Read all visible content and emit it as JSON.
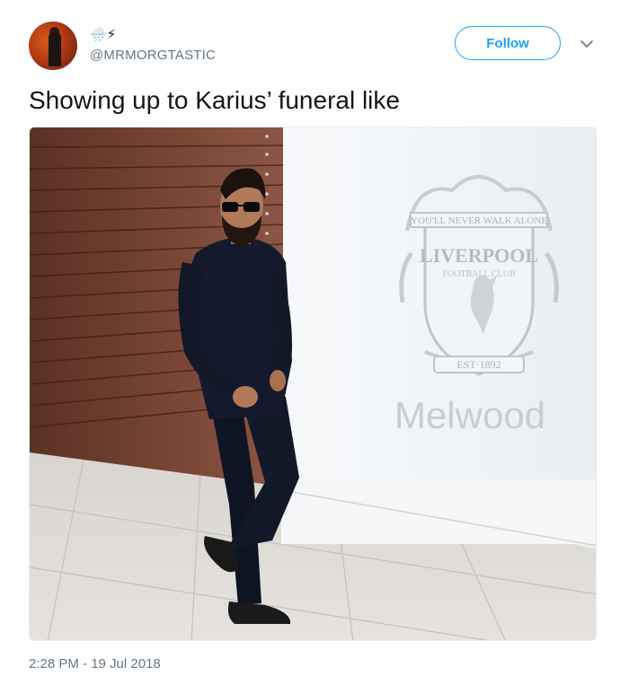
{
  "user": {
    "handle": "@MRMORGTASTIC",
    "name_emoji": "🌧️⚡"
  },
  "follow_button": {
    "label": "Follow"
  },
  "tweet": {
    "text": "Showing up to Karius’ funeral like",
    "timestamp": "2:28 PM - 19 Jul 2018"
  },
  "image": {
    "sign_motto": "YOU'LL NEVER WALK ALONE",
    "sign_club_name": "LIVERPOOL",
    "sign_subtitle": "FOOTBALL CLUB",
    "sign_est": "EST·1892",
    "sign_venue": "Melwood"
  },
  "colors": {
    "accent": "#1da1f2",
    "secondary_text": "#657786",
    "primary_text": "#14171a"
  },
  "icons": {
    "caret": "chevron-down-icon"
  }
}
